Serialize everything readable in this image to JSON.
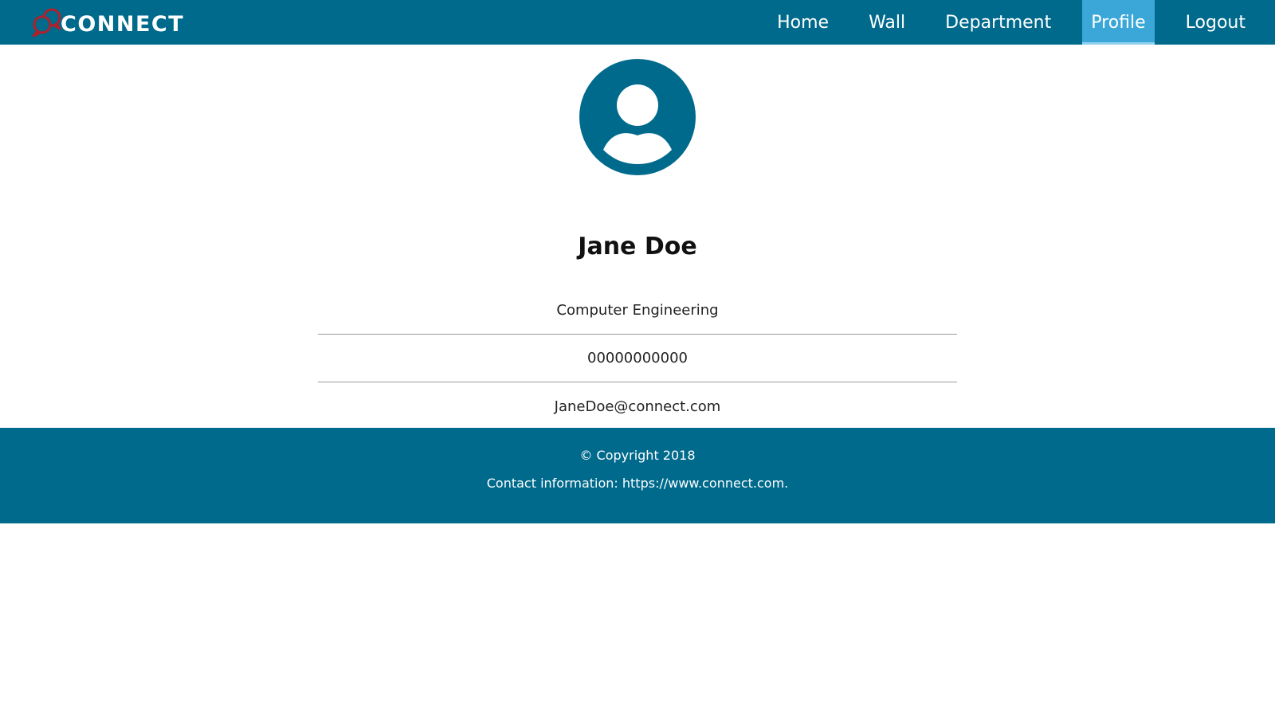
{
  "brand": {
    "name": "CONNECT",
    "icon": "chat-bubbles-icon",
    "icon_color": "#b0202a"
  },
  "colors": {
    "primary": "#006a8c",
    "active_tab": "#3aa7d8",
    "text_dark": "#111111"
  },
  "nav": {
    "items": [
      {
        "label": "Home",
        "active": false
      },
      {
        "label": "Wall",
        "active": false
      },
      {
        "label": "Department",
        "active": false
      },
      {
        "label": "Profile",
        "active": true
      },
      {
        "label": "Logout",
        "active": false
      }
    ]
  },
  "profile": {
    "avatar_icon": "user-avatar-icon",
    "name": "Jane Doe",
    "department": "Computer Engineering",
    "phone": "00000000000",
    "email": "JaneDoe@connect.com"
  },
  "footer": {
    "copyright": "© Copyright 2018",
    "contact": "Contact information: https://www.connect.com."
  }
}
